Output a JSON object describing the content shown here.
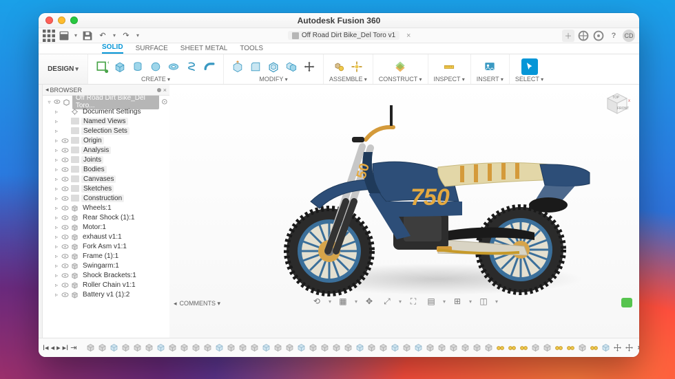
{
  "app": {
    "title": "Autodesk Fusion 360"
  },
  "document": {
    "tab_label": "Off Road Dirt Bike_Del Toro v1"
  },
  "qat": {
    "user_initials": "CD"
  },
  "workspace": {
    "label": "DESIGN"
  },
  "ribbon_tabs": [
    "SOLID",
    "SURFACE",
    "SHEET METAL",
    "TOOLS"
  ],
  "ribbon_active_tab": "SOLID",
  "ribbon_groups": {
    "create": "CREATE",
    "modify": "MODIFY",
    "assemble": "ASSEMBLE",
    "construct": "CONSTRUCT",
    "inspect": "INSPECT",
    "insert": "INSERT",
    "select": "SELECT"
  },
  "browser": {
    "title": "BROWSER",
    "root": "Off Road Dirt Bike_Del Toro...",
    "items": [
      {
        "label": "Document Settings",
        "bg": false,
        "eye": false,
        "icon": "gear"
      },
      {
        "label": "Named Views",
        "bg": true,
        "eye": false,
        "icon": "folder"
      },
      {
        "label": "Selection Sets",
        "bg": true,
        "eye": false,
        "icon": "folder"
      },
      {
        "label": "Origin",
        "bg": true,
        "eye": true,
        "icon": "folder"
      },
      {
        "label": "Analysis",
        "bg": true,
        "eye": true,
        "icon": "folder"
      },
      {
        "label": "Joints",
        "bg": true,
        "eye": true,
        "icon": "folder"
      },
      {
        "label": "Bodies",
        "bg": true,
        "eye": true,
        "icon": "folder"
      },
      {
        "label": "Canvases",
        "bg": true,
        "eye": true,
        "icon": "folder"
      },
      {
        "label": "Sketches",
        "bg": true,
        "eye": true,
        "icon": "folder"
      },
      {
        "label": "Construction",
        "bg": true,
        "eye": true,
        "icon": "folder"
      },
      {
        "label": "Wheels:1",
        "bg": false,
        "eye": true,
        "icon": "comp"
      },
      {
        "label": "Rear Shock (1):1",
        "bg": false,
        "eye": true,
        "icon": "comp"
      },
      {
        "label": "Motor:1",
        "bg": false,
        "eye": true,
        "icon": "comp"
      },
      {
        "label": "exhaust v1:1",
        "bg": false,
        "eye": true,
        "icon": "comp"
      },
      {
        "label": "Fork Asm v1:1",
        "bg": false,
        "eye": true,
        "icon": "comp"
      },
      {
        "label": "Frame (1):1",
        "bg": false,
        "eye": true,
        "icon": "comp"
      },
      {
        "label": "Swingarm:1",
        "bg": false,
        "eye": true,
        "icon": "comp"
      },
      {
        "label": "Shock Brackets:1",
        "bg": false,
        "eye": true,
        "icon": "comp"
      },
      {
        "label": "Roller Chain v1:1",
        "bg": false,
        "eye": true,
        "icon": "comp"
      },
      {
        "label": "Battery v1 (1):2",
        "bg": false,
        "eye": true,
        "icon": "comp"
      }
    ]
  },
  "viewcube": {
    "top": "TOP",
    "front": "FRONT"
  },
  "comments_label": "COMMENTS",
  "bike_number": "750"
}
